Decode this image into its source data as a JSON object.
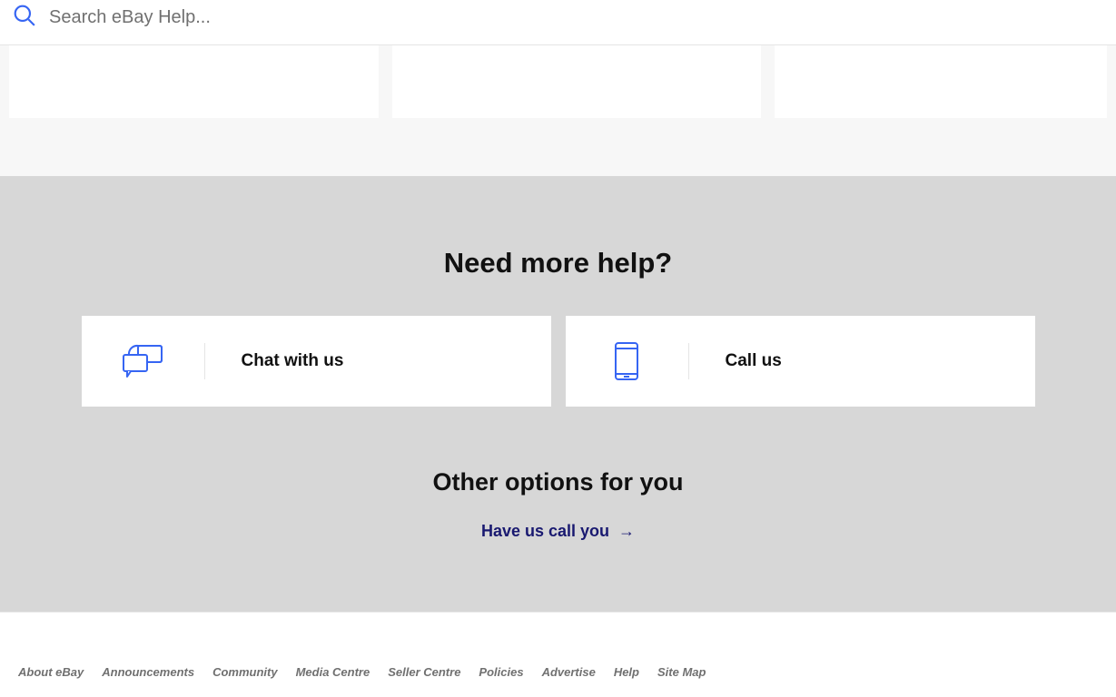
{
  "search": {
    "placeholder": "Search eBay Help..."
  },
  "help": {
    "heading": "Need more help?",
    "cards": [
      {
        "label": "Chat with us",
        "icon": "chat-icon"
      },
      {
        "label": "Call us",
        "icon": "phone-icon"
      }
    ],
    "other_heading": "Other options for you",
    "call_link": "Have us call you"
  },
  "footer": {
    "links": [
      "About eBay",
      "Announcements",
      "Community",
      "Media Centre",
      "Seller Centre",
      "Policies",
      "Advertise",
      "Help",
      "Site Map"
    ]
  }
}
